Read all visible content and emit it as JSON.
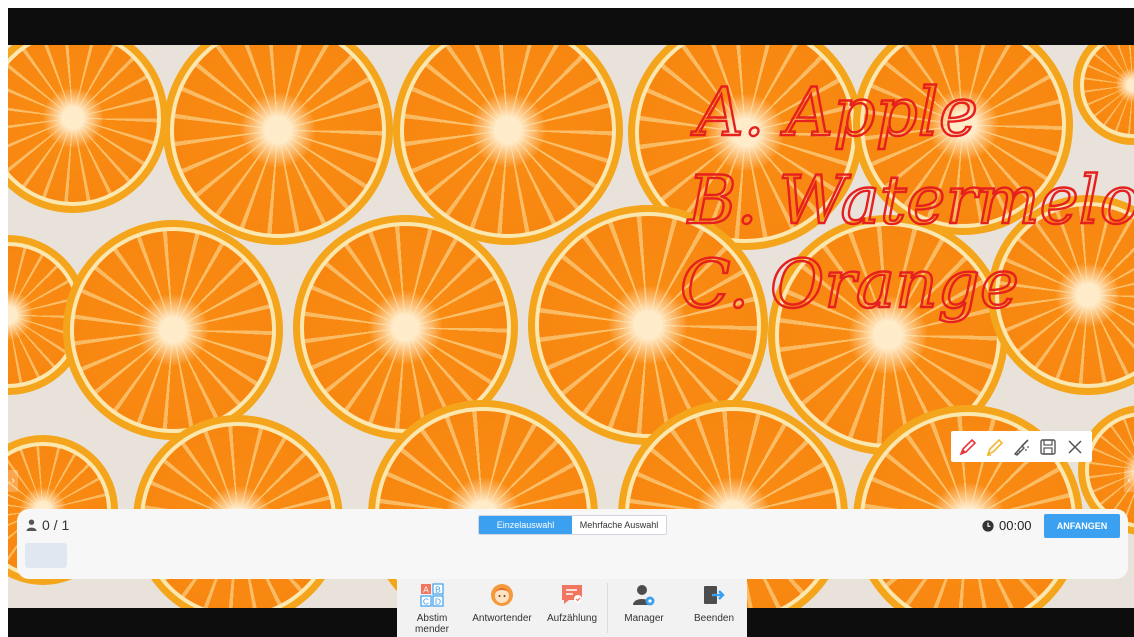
{
  "annotation": {
    "lines": [
      "A. Apple",
      "B. Watermelon",
      "C. Orange"
    ],
    "ink_color": "#e6201f"
  },
  "annotation_toolbar": {
    "icons": [
      "pen-icon",
      "highlighter-icon",
      "eraser-brush-icon",
      "save-icon",
      "close-icon"
    ]
  },
  "vote_panel": {
    "participants": "0 / 1",
    "mode_tabs": [
      {
        "label": "Einzelauswahl",
        "active": true
      },
      {
        "label": "Mehrfache Auswahl",
        "active": false
      }
    ],
    "timer": "00:00",
    "start_label": "ANFANGEN"
  },
  "dock": {
    "items": [
      {
        "label": "Abstim\nmender",
        "icon": "abcd-grid-icon"
      },
      {
        "label": "Antwortender",
        "icon": "responder-face-icon"
      },
      {
        "label": "Aufzählung",
        "icon": "list-chat-icon"
      },
      {
        "label": "Manager",
        "icon": "user-gear-icon"
      },
      {
        "label": "Beenden",
        "icon": "exit-icon"
      }
    ]
  },
  "colors": {
    "accent": "#3aa0ef",
    "background_bar": "#0d0d0d",
    "panel": "#f7f7f7"
  }
}
